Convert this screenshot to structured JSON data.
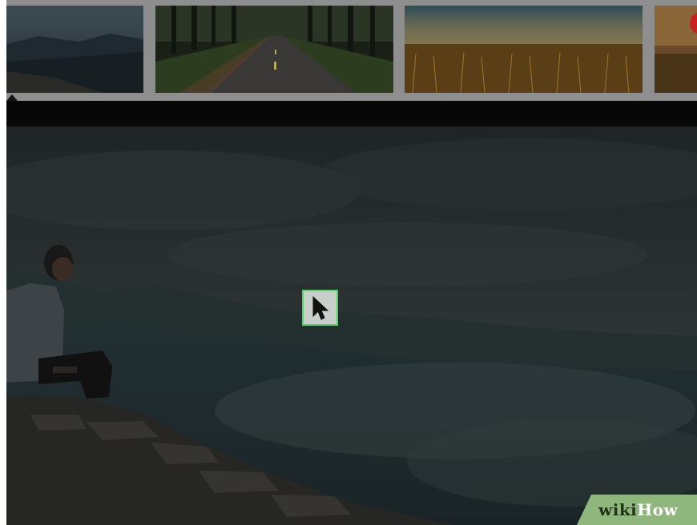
{
  "viewer": {
    "thumbnails": [
      {
        "scene": "mountain-valley",
        "selected": true
      },
      {
        "scene": "forest-road",
        "selected": false
      },
      {
        "scene": "wheat-field",
        "selected": false
      },
      {
        "scene": "sunset-partial",
        "selected": false
      }
    ],
    "main_image": {
      "scene": "man-sitting-on-rock-overlooking-valley",
      "dimmed": true
    },
    "cursor": {
      "icon": "arrow-cursor-icon",
      "highlight_color": "#5cd26a"
    }
  },
  "watermark": {
    "wiki": "wiki",
    "how": "How",
    "bg_color": "#8fb67d"
  }
}
